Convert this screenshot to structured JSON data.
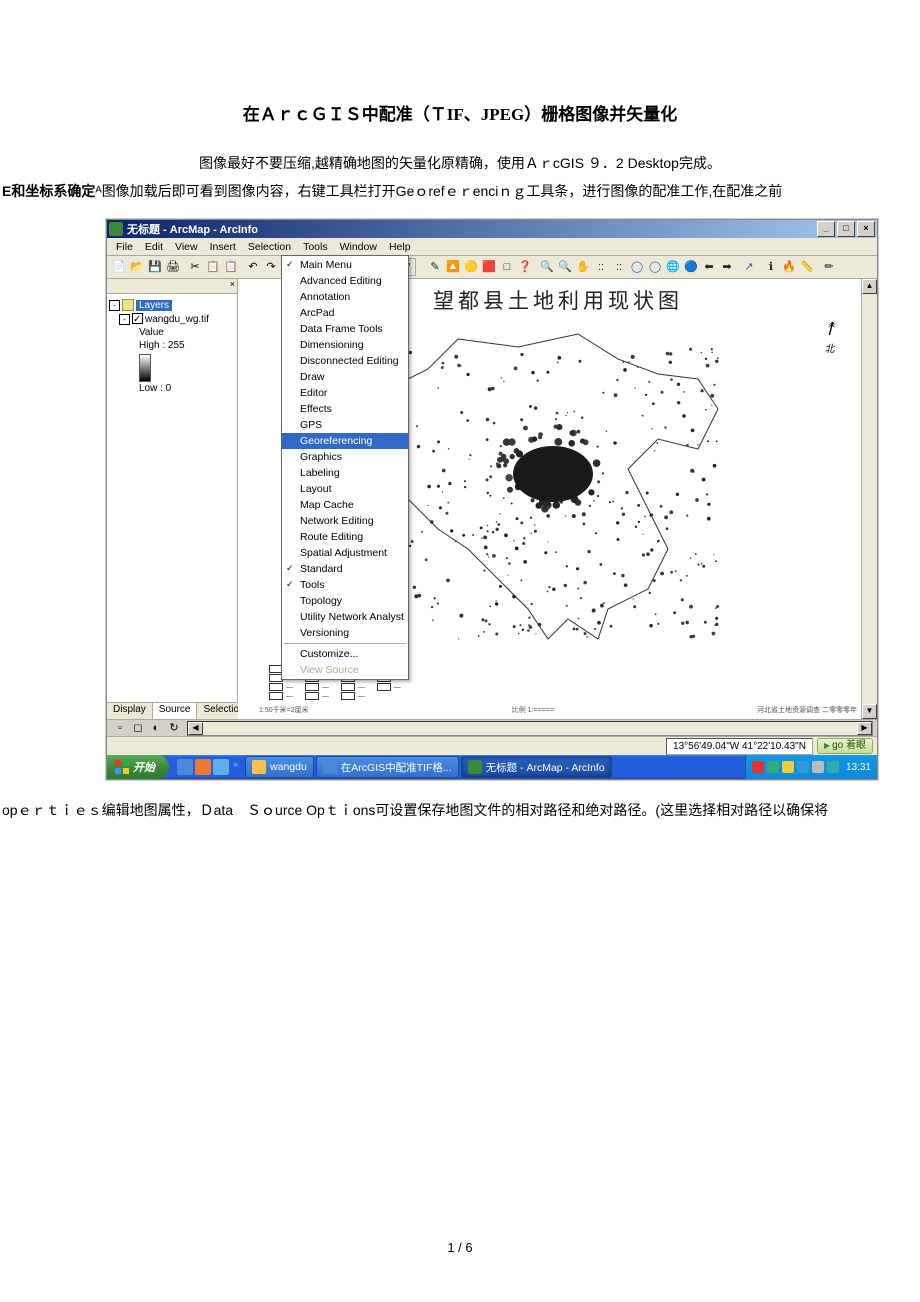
{
  "doc": {
    "title": "在ＡｒｃＧＩＳ中配准（ＴIF、JPEG）栅格图像并矢量化",
    "line1": "图像最好不要压缩,越精确地图的矢量化原精确，使用ＡｒcGIS ９．2 Desktop完成。",
    "line2_bold": "E和坐标系确定",
    "line2_rest": "ᴬ图像加载后即可看到图像内容，右键工具栏打开Geｏrefｅｒenciｎｇ工具条，进行图像的配准工作,在配准之前",
    "line3": "opｅｒｔｉｅｓ编辑地图属性，Ｄata　Ｓｏurce Opｔｉons可设置保存地图文件的相对路径和绝对路径。(这里选择相对路径以确保将",
    "pagenum": "1 / 6"
  },
  "shot": {
    "title": "无标题 - ArcMap - ArcInfo",
    "winbtns": {
      "min": "_",
      "max": "□",
      "close": "×"
    },
    "menubar": [
      "File",
      "Edit",
      "View",
      "Insert",
      "Selection",
      "Tools",
      "Window",
      "Help"
    ],
    "coord": "179, 335",
    "toolbar1_icons": [
      "📄",
      "📂",
      "💾",
      "🖨",
      "",
      "✂",
      "📋",
      "📋",
      "",
      "↶",
      "↷",
      "",
      "+"
    ],
    "toolbar2_icons": [
      "✎",
      "🔼",
      "🟡",
      "🟥",
      "□",
      "❓",
      "",
      "🔍",
      "🔍",
      "✋",
      "::",
      "::",
      "◯",
      "◯",
      "🌐",
      "🔵",
      "⬅",
      "➡",
      "",
      "↗",
      "",
      "ℹ",
      "🔥",
      "📏",
      "",
      "✏"
    ],
    "toolbar2_colors": [
      "#222",
      "#222",
      "#c90",
      "#b22",
      "#222",
      "#222",
      "",
      "#222",
      "#222",
      "#222",
      "#222",
      "#222",
      "#36c",
      "#36c",
      "#39c",
      "#36c",
      "#222",
      "#222",
      "",
      "#36c",
      "",
      "#222",
      "#b22",
      "#222",
      "",
      "#222"
    ],
    "toc": {
      "layers_label": "Layers",
      "raster": "wangdu_wg.tif",
      "value": "Value",
      "high": "High : 255",
      "low": "Low : 0",
      "tabs": [
        "Display",
        "Source",
        "Selection"
      ]
    },
    "dropdown": [
      {
        "label": "Main Menu",
        "checked": true
      },
      {
        "label": "Advanced Editing"
      },
      {
        "label": "Annotation"
      },
      {
        "label": "ArcPad"
      },
      {
        "label": "Data Frame Tools"
      },
      {
        "label": "Dimensioning"
      },
      {
        "label": "Disconnected Editing"
      },
      {
        "label": "Draw"
      },
      {
        "label": "Editor"
      },
      {
        "label": "Effects"
      },
      {
        "label": "GPS"
      },
      {
        "label": "Georeferencing",
        "sel": true
      },
      {
        "label": "Graphics"
      },
      {
        "label": "Labeling"
      },
      {
        "label": "Layout"
      },
      {
        "label": "Map Cache"
      },
      {
        "label": "Network Editing"
      },
      {
        "label": "Route Editing"
      },
      {
        "label": "Spatial Adjustment"
      },
      {
        "label": "Standard",
        "checked": true
      },
      {
        "label": "Tools",
        "checked": true
      },
      {
        "label": "Topology"
      },
      {
        "label": "Utility Network Analyst"
      },
      {
        "label": "Versioning"
      },
      {
        "sep": true
      },
      {
        "label": "Customize..."
      },
      {
        "label": "View Source",
        "disabled": true
      }
    ],
    "map": {
      "title": "望都县土地利用现状图",
      "compass": "北",
      "footer_left": "1:50千米=2厘米",
      "footer_mid": "比例   1:=====",
      "footer_right": "河北省土地资源调查   二零零零年"
    },
    "viewbar": {
      "icons": [
        "▫",
        "◻",
        "◐",
        "↻"
      ]
    },
    "status": {
      "coords": "13°56'49.04\"W  41°22'10.43\"N",
      "go": "go 着眼"
    },
    "taskbar": {
      "start": "开始",
      "tasks": [
        {
          "icon": "#f7c24b",
          "label": "wangdu"
        },
        {
          "icon": "#4a88d8",
          "label": "在ArcGIS中配准TIF格..."
        },
        {
          "icon": "#3a883a",
          "label": "无标题 - ArcMap - ArcInfo",
          "active": true
        }
      ],
      "clock": "13:31"
    }
  }
}
